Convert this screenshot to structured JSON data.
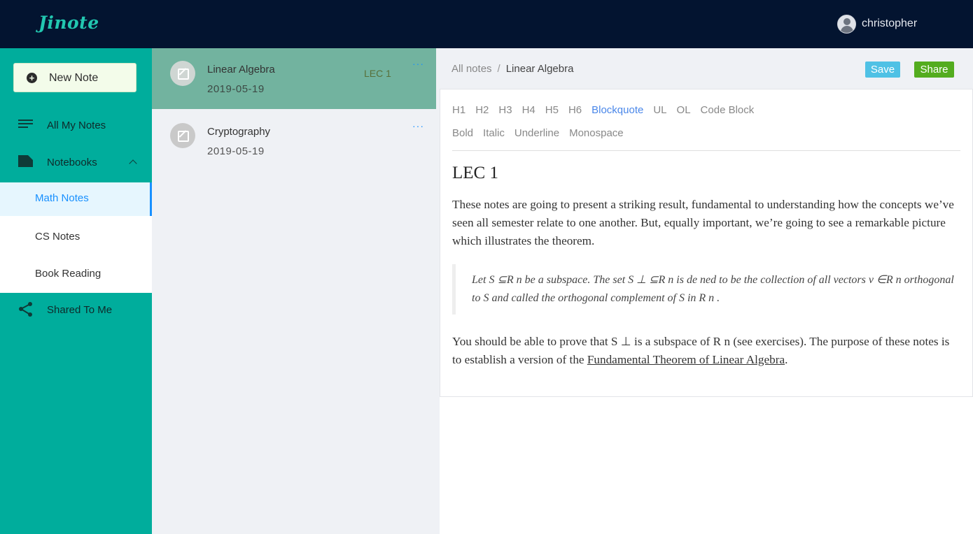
{
  "app": {
    "logo": "Jinote"
  },
  "user": {
    "name": "christopher"
  },
  "sidebar": {
    "new_note_label": "New Note",
    "all_notes_label": "All My Notes",
    "notebooks_label": "Notebooks",
    "notebooks": [
      "Math Notes",
      "CS Notes",
      "Book Reading"
    ],
    "active_notebook": "Math Notes",
    "shared_label": "Shared To Me"
  },
  "notes": [
    {
      "title": "Linear Algebra",
      "date": "2019-05-19",
      "tag": "LEC 1",
      "more": "···"
    },
    {
      "title": "Cryptography",
      "date": "2019-05-19",
      "tag": "",
      "more": "···"
    }
  ],
  "breadcrumb": {
    "root": "All notes",
    "separator": "/",
    "current": "Linear Algebra"
  },
  "actions": {
    "save": "Save",
    "share": "Share"
  },
  "toolbar": {
    "row1": [
      "H1",
      "H2",
      "H3",
      "H4",
      "H5",
      "H6",
      "Blockquote",
      "UL",
      "OL",
      "Code Block"
    ],
    "row2": [
      "Bold",
      "Italic",
      "Underline",
      "Monospace"
    ],
    "active": "Blockquote"
  },
  "document": {
    "heading": "LEC 1",
    "para1": "These notes are going to present a striking result, fundamental to understanding how the concepts we’ve seen all semester relate to one another. But, equally important, we’re going to see a remarkable picture which illustrates the theorem.",
    "quote": "Let S ⊆R n be a subspace. The set S ⊥ ⊆R n is de  ned to be the collection of all vectors v ∈R n orthogonal to S and called the orthogonal complement of S in R n .",
    "para2_before": "You should be able to prove that S ⊥ is a subspace of R n (see exercises). The purpose of these notes is to establish a version of the ",
    "para2_link": "Fundamental Theorem of Linear Algebra",
    "para2_after": "."
  },
  "colors": {
    "topbar": "#031430",
    "sidebar": "#00ad9c",
    "active_note": "#72b39f",
    "accent_blue": "#1890ff",
    "save_button": "#4fc1e5",
    "share_button": "#53ac1f"
  }
}
